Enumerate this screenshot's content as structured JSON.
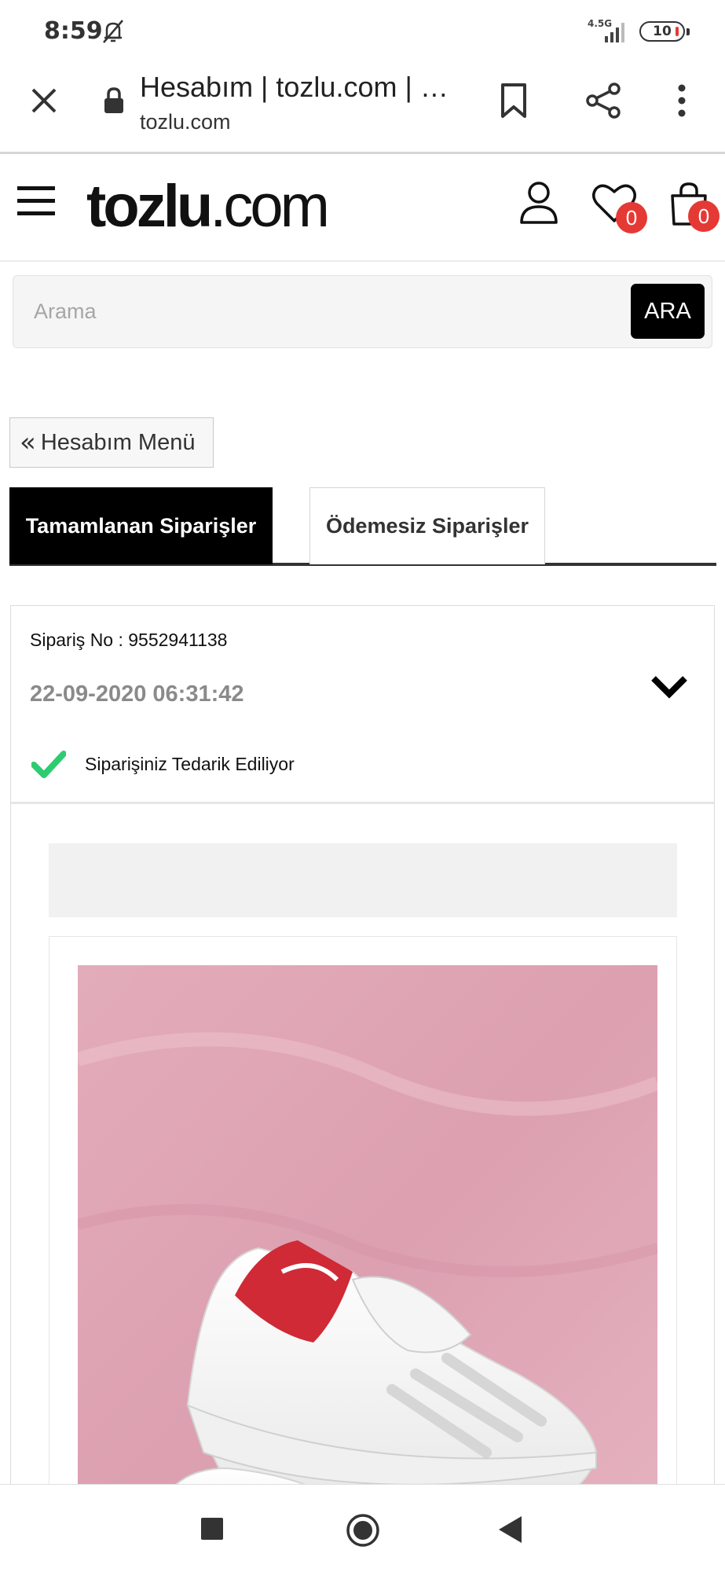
{
  "status_bar": {
    "time": "8:59",
    "network": "4.5G",
    "battery": "10"
  },
  "browser": {
    "page_title": "Hesabım | tozlu.com | …",
    "url": "tozlu.com"
  },
  "site_header": {
    "logo_bold": "tozlu",
    "logo_light": ".com",
    "wishlist_count": "0",
    "cart_count": "0"
  },
  "search": {
    "placeholder": "Arama",
    "button_label": "ARA"
  },
  "account_menu": {
    "label": "Hesabım Menü"
  },
  "tabs": [
    {
      "label": "Tamamlanan Siparişler",
      "active": true
    },
    {
      "label": "Ödemesiz Siparişler",
      "active": false
    }
  ],
  "order": {
    "number_label": "Sipariş No : 9552941138",
    "date": "22-09-2020 06:31:42",
    "status": "Siparişiniz Tedarik Ediliyor"
  },
  "colors": {
    "badge": "#e53935",
    "check": "#2ecc71",
    "active_tab": "#000000",
    "product_background": "#e0a7b6",
    "shoe_accent": "#d32f2f"
  },
  "icons": [
    "close-icon",
    "lock-icon",
    "bookmark-icon",
    "share-icon",
    "more-icon",
    "menu-icon",
    "user-icon",
    "heart-icon",
    "cart-icon",
    "chevron-down-icon",
    "check-icon"
  ]
}
